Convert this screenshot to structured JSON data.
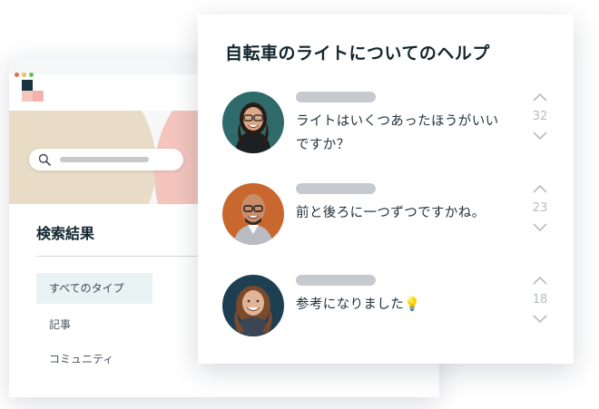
{
  "search_page": {
    "results_heading": "検索結果",
    "filters": [
      {
        "label": "すべてのタイプ",
        "active": true
      },
      {
        "label": "記事",
        "active": false
      },
      {
        "label": "コミュニティ",
        "active": false
      }
    ]
  },
  "help_card": {
    "title": "自転車のライトについてのヘルプ",
    "posts": [
      {
        "text": "ライトはいくつあったほうがいいですか？",
        "votes": "32",
        "avatar": "woman-glasses-avatar"
      },
      {
        "text": "前と後ろに一つずつですかね。",
        "votes": "23",
        "avatar": "man-glasses-avatar"
      },
      {
        "text": "参考になりました💡",
        "votes": "18",
        "avatar": "woman-smiling-avatar"
      }
    ]
  },
  "colors": {
    "accent_beige": "#e8dcc7",
    "accent_pink": "#f3c5bd",
    "brand_dark": "#17313e",
    "placeholder_gray": "#c6cacf"
  }
}
